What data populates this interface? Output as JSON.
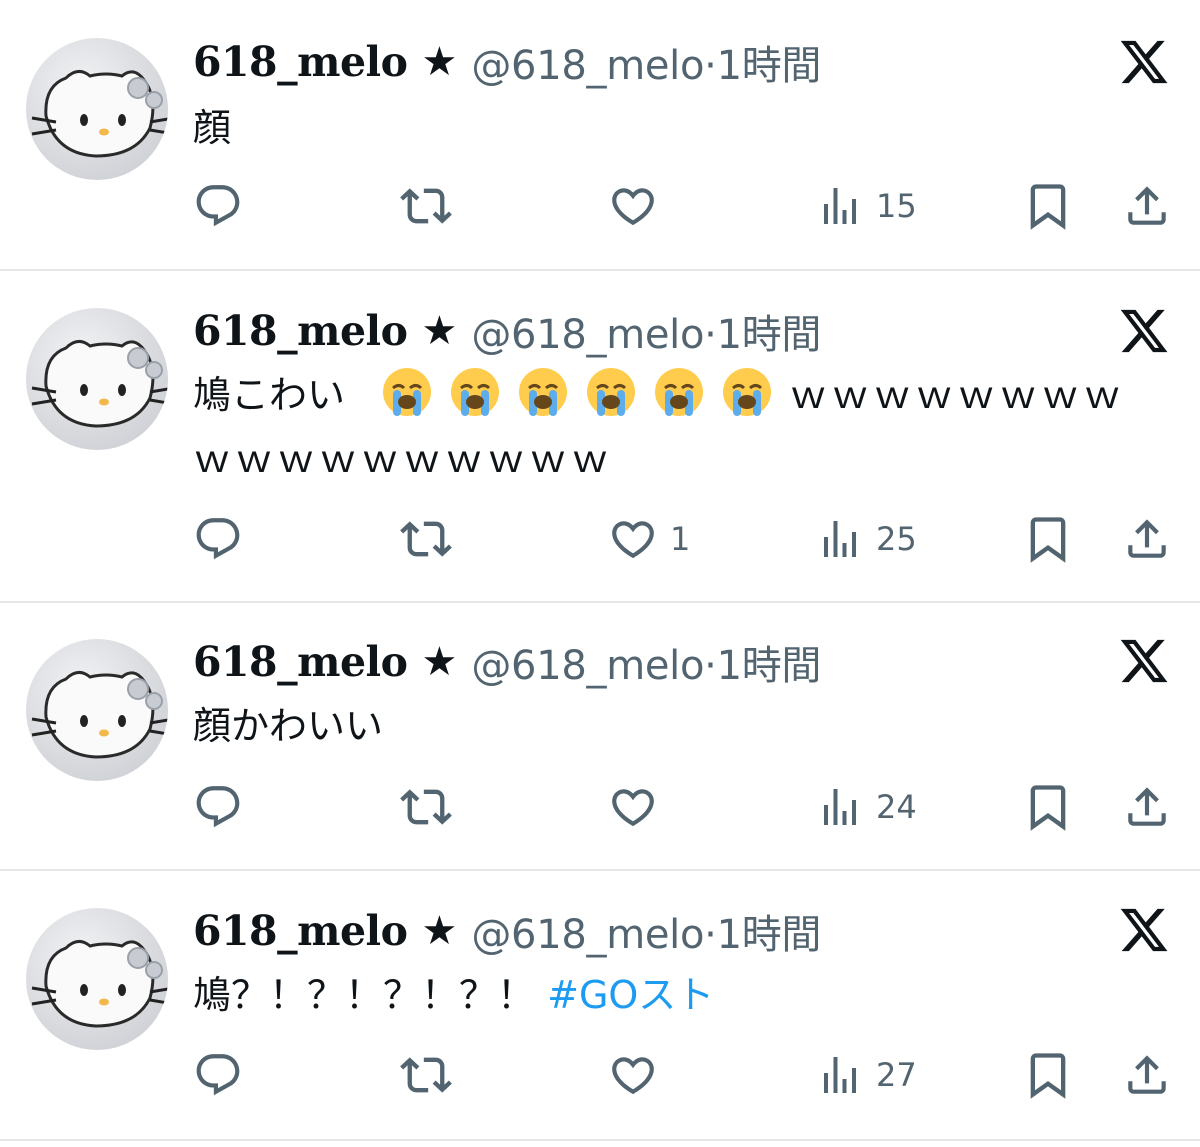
{
  "tweets": [
    {
      "name": "618_melo",
      "star": "★",
      "handle": "@618_melo",
      "separator": "·",
      "time": "1時間",
      "text_lines": [
        "顔"
      ],
      "emoji_count": 0,
      "likes": "",
      "views": "15"
    },
    {
      "name": "618_melo",
      "star": "★",
      "handle": "@618_melo",
      "separator": "·",
      "time": "1時間",
      "text_prefix": "鳩こわい",
      "emoji": "loudly-crying-face",
      "emoji_count": 6,
      "text_suffix": "ｗｗｗｗｗｗｗｗ",
      "text_line2": "ｗｗｗｗｗｗｗｗｗｗ",
      "likes": "1",
      "views": "25"
    },
    {
      "name": "618_melo",
      "star": "★",
      "handle": "@618_melo",
      "separator": "·",
      "time": "1時間",
      "text_lines": [
        "顔かわいい"
      ],
      "emoji_count": 0,
      "likes": "",
      "views": "24"
    },
    {
      "name": "618_melo",
      "star": "★",
      "handle": "@618_melo",
      "separator": "·",
      "time": "1時間",
      "text_prefix": "鳩？！？！？！？！",
      "hashtag": "#GOスト",
      "emoji_count": 0,
      "likes": "",
      "views": "27"
    }
  ],
  "icons": {
    "reply": "reply-icon",
    "retweet": "retweet-icon",
    "like": "heart-icon",
    "views": "analytics-icon",
    "bookmark": "bookmark-icon",
    "share": "share-icon",
    "brand": "x-logo-icon"
  },
  "colors": {
    "text": "#0f1419",
    "muted": "#536471",
    "link": "#1d9bf0",
    "divider": "#e6e6e6"
  }
}
